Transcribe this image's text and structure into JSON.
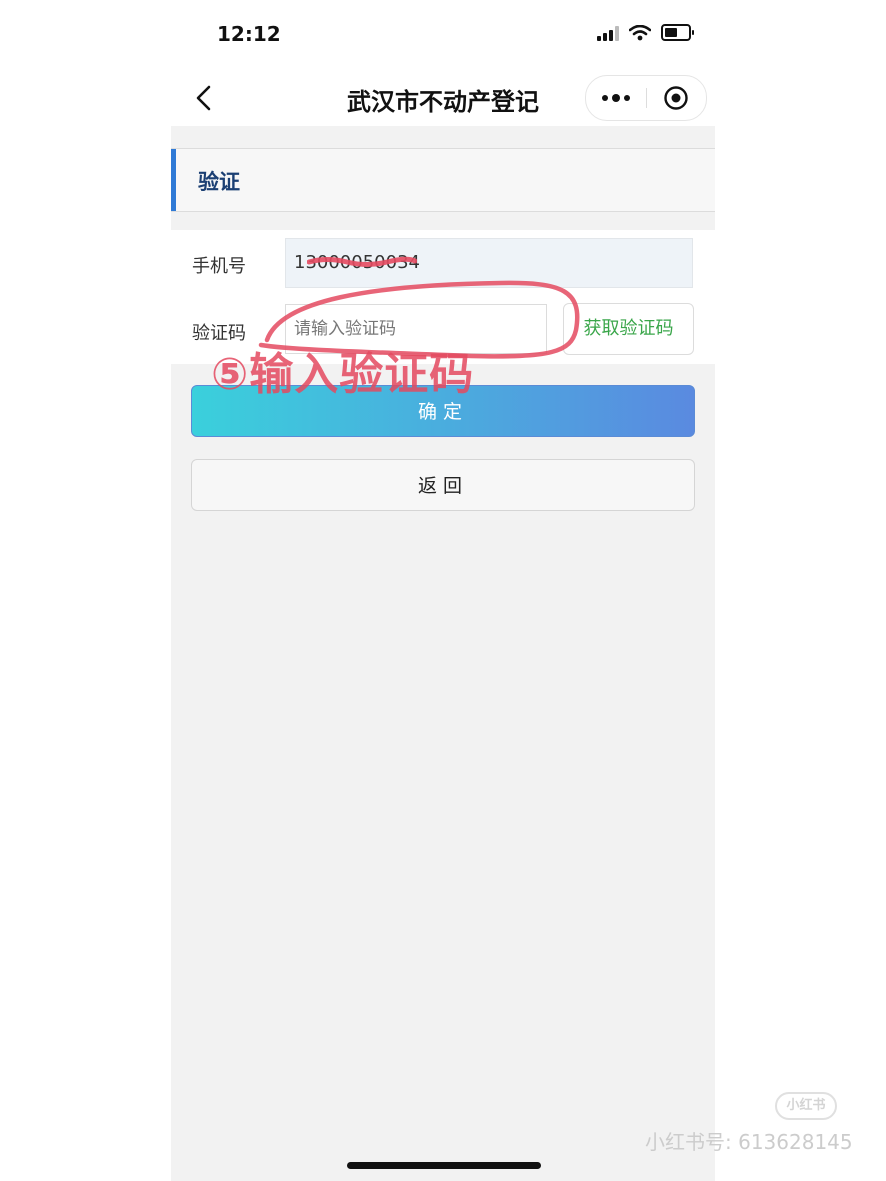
{
  "status_bar": {
    "time": "12:12"
  },
  "navbar": {
    "title": "武汉市不动产登记"
  },
  "section": {
    "title": "验证"
  },
  "form": {
    "phone_label": "手机号",
    "phone_value": "13000050034",
    "code_label": "验证码",
    "code_placeholder": "请输入验证码",
    "get_code_label": "获取验证码"
  },
  "buttons": {
    "confirm_label": "确定",
    "back_label": "返回"
  },
  "annotation": {
    "text": "⑤输入验证码",
    "color": "#e44a60"
  },
  "watermark": {
    "logo": "小红书",
    "id_text": "小红书号: 613628145"
  },
  "colors": {
    "accent_blue": "#2f7ad6",
    "green_text": "#3aa64a",
    "page_bg": "#f2f2f2"
  }
}
